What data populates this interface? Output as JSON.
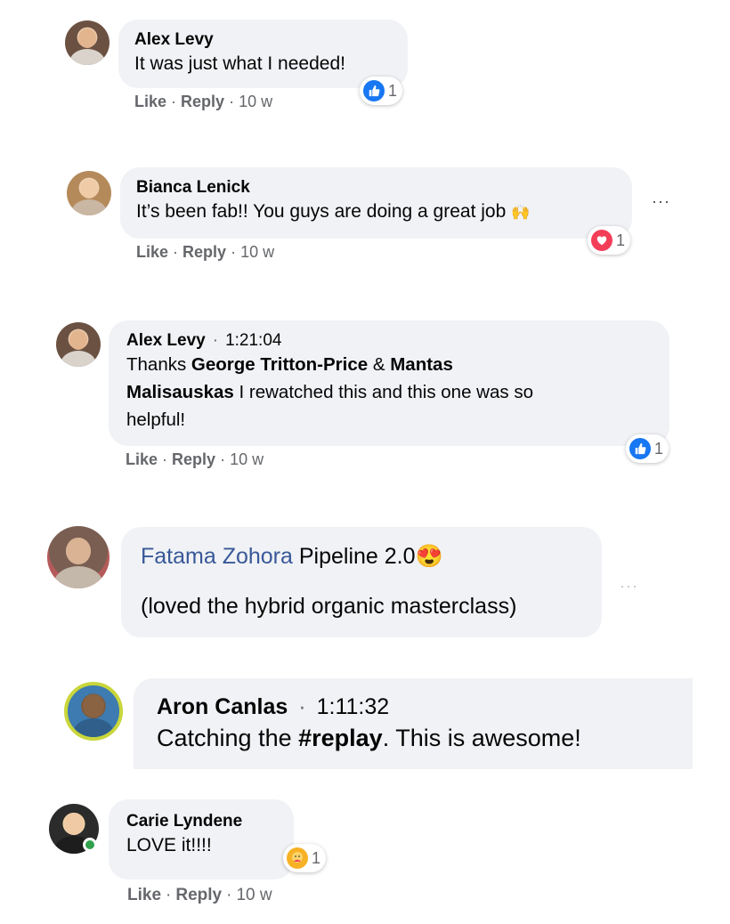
{
  "comments": [
    {
      "author": "Alex Levy",
      "text": "It was just what I needed!",
      "like": "Like",
      "reply": "Reply",
      "age": "10 w",
      "reaction_count": "1",
      "reaction_type": "like-icon"
    },
    {
      "author": "Bianca Lenick",
      "text": "It’s been fab!! You guys are doing a great job",
      "emoji": "🙌",
      "like": "Like",
      "reply": "Reply",
      "age": "10 w",
      "reaction_count": "1",
      "reaction_type": "love-icon",
      "more": "···"
    },
    {
      "author": "Alex Levy",
      "timestamp": "1:21:04",
      "text_a": "Thanks ",
      "mention1": "George Tritton-Price",
      "text_b": " & ",
      "mention2a": "Mantas",
      "mention2b": "Malisauskas",
      "text_c": " I rewatched this and this one was so",
      "text_d": "helpful!",
      "like": "Like",
      "reply": "Reply",
      "age": "10 w",
      "reaction_count": "1",
      "reaction_type": "like-icon"
    },
    {
      "author": "Fatama Zohora",
      "text": " Pipeline 2.0",
      "emoji": "😍",
      "text2": "(loved the hybrid organic masterclass)",
      "more": "···"
    },
    {
      "author": "Aron Canlas",
      "timestamp": "1:11:32",
      "text_a": "Catching the ",
      "hashtag": "#replay",
      "text_b": ". This is awesome!"
    },
    {
      "author": "Carie Lyndene",
      "text": "LOVE it!!!!",
      "like": "Like",
      "reply": "Reply",
      "age": "10 w",
      "reaction_count": "1",
      "reaction_type": "care-icon"
    }
  ],
  "colors": {
    "bubble": "#f0f2f5",
    "meta": "#65676b",
    "link": "#385898",
    "like_blue": "#1877f2",
    "love_red": "#f33e58"
  }
}
